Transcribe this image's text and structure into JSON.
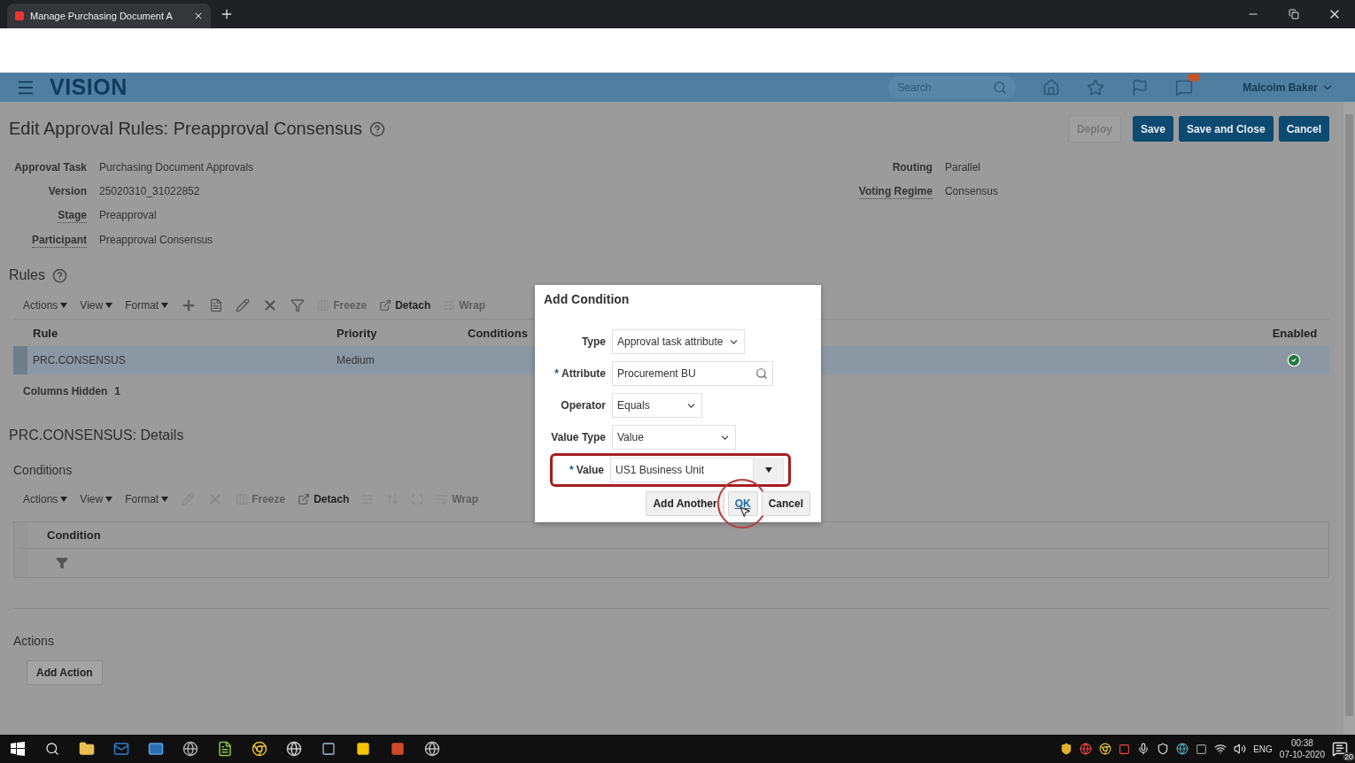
{
  "browser": {
    "tab_title": "Manage Purchasing Document A"
  },
  "header": {
    "brand": "VISION",
    "search_placeholder": "Search",
    "user": "Malcolm Baker"
  },
  "page": {
    "title": "Edit Approval Rules: Preapproval Consensus",
    "buttons": [
      {
        "label": "Deploy",
        "disabled": true
      },
      {
        "label": "Save",
        "disabled": false
      },
      {
        "label": "Save and Close",
        "disabled": false
      },
      {
        "label": "Cancel",
        "disabled": false
      }
    ],
    "fields_left": [
      {
        "label": "Approval Task",
        "value": "Purchasing Document Approvals",
        "link": false
      },
      {
        "label": "Version",
        "value": "25020310_31022852",
        "link": false
      },
      {
        "label": "Stage",
        "value": "Preapproval",
        "link": true
      },
      {
        "label": "Participant",
        "value": "Preapproval Consensus",
        "link": true
      }
    ],
    "fields_right": [
      {
        "label": "Routing",
        "value": "Parallel",
        "link": false
      },
      {
        "label": "Voting Regime",
        "value": "Consensus",
        "link": true
      }
    ]
  },
  "rules": {
    "title": "Rules",
    "menus": [
      "Actions",
      "View",
      "Format"
    ],
    "buttons": [
      {
        "label": "Freeze",
        "disabled": true
      },
      {
        "label": "Detach",
        "disabled": false
      },
      {
        "label": "Wrap",
        "disabled": true
      }
    ],
    "columns": [
      "Rule",
      "Priority",
      "Conditions",
      "Enabled"
    ],
    "rows": [
      {
        "rule": "PRC.CONSENSUS",
        "priority": "Medium",
        "enabled": true,
        "selected": true
      }
    ],
    "columns_hidden_label": "Columns Hidden",
    "columns_hidden_count": "1"
  },
  "details": {
    "title": "PRC.CONSENSUS: Details",
    "conditions_title": "Conditions",
    "menus": [
      "Actions",
      "View",
      "Format"
    ],
    "buttons": [
      {
        "label": "Freeze",
        "disabled": true
      },
      {
        "label": "Detach",
        "disabled": false
      },
      {
        "label": "Wrap",
        "disabled": true
      }
    ],
    "columns": [
      "Condition"
    ],
    "actions_title": "Actions",
    "add_action": "Add Action"
  },
  "dialog": {
    "title": "Add Condition",
    "required_mark": "*",
    "rows": [
      {
        "label": "Type",
        "required": false,
        "kind": "select",
        "value": "Approval task attribute",
        "highlighted": false
      },
      {
        "label": "Attribute",
        "required": true,
        "kind": "search",
        "value": "Procurement BU",
        "highlighted": false
      },
      {
        "label": "Operator",
        "required": false,
        "kind": "select",
        "value": "Equals",
        "highlighted": false
      },
      {
        "label": "Value Type",
        "required": false,
        "kind": "select",
        "value": "Value",
        "highlighted": false
      },
      {
        "label": "Value",
        "required": true,
        "kind": "combo",
        "value": "US1 Business Unit",
        "highlighted": true
      }
    ],
    "buttons": [
      {
        "label": "Add Another",
        "circled": false
      },
      {
        "label": "OK",
        "circled": true
      },
      {
        "label": "Cancel",
        "circled": false
      }
    ]
  },
  "taskbar": {
    "language": "ENG",
    "time": "00:38",
    "date": "07-10-2020",
    "notifications": "20"
  }
}
